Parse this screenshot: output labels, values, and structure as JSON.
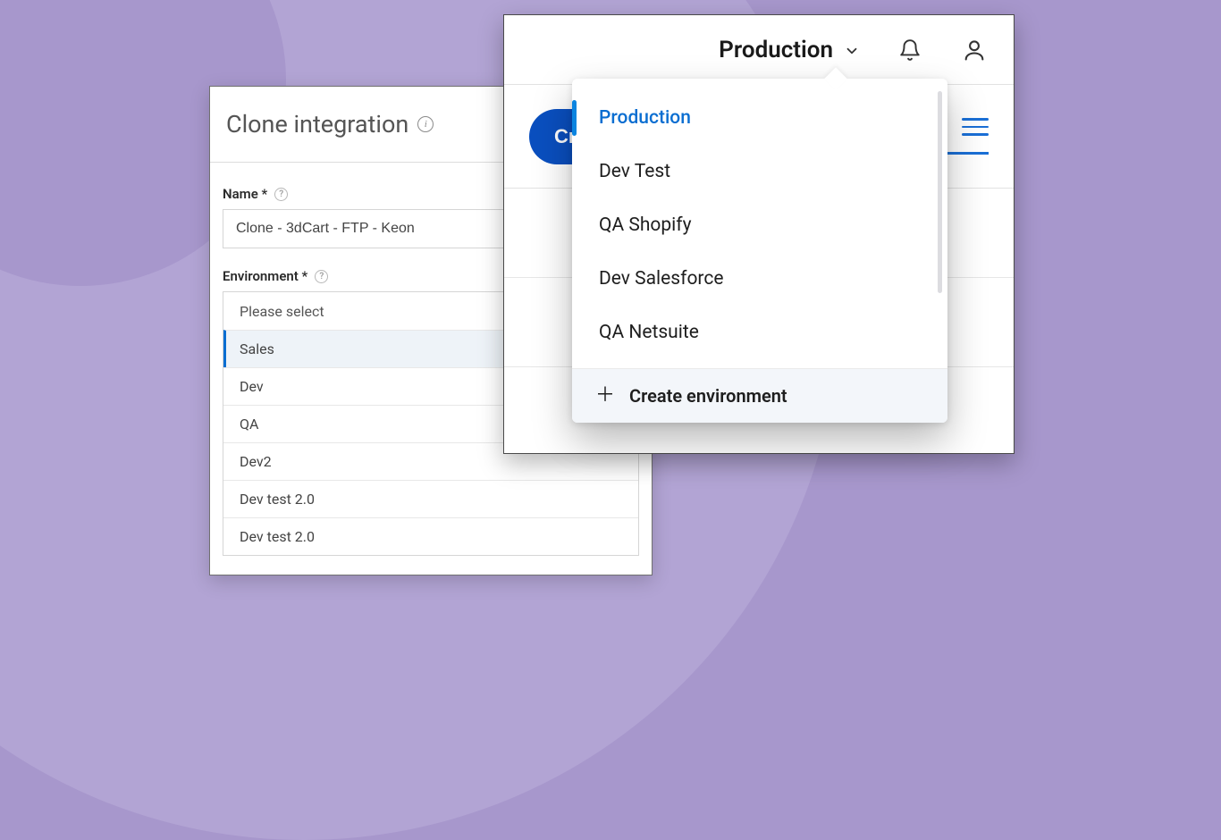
{
  "clone_panel": {
    "title": "Clone integration",
    "name_field": {
      "label": "Name *",
      "value": "Clone - 3dCart - FTP - Keon"
    },
    "environment_field": {
      "label": "Environment *",
      "placeholder": "Please select",
      "options": [
        "Sales",
        "Dev",
        "QA",
        "Dev2",
        "Dev test 2.0",
        "Dev test 2.0"
      ],
      "selected_index": 0
    }
  },
  "header": {
    "environment_label": "Production",
    "create_button_label": "Create"
  },
  "env_menu": {
    "items": [
      "Production",
      "Dev Test",
      "QA Shopify",
      "Dev Salesforce",
      "QA Netsuite"
    ],
    "active_index": 0,
    "create_label": "Create environment"
  }
}
